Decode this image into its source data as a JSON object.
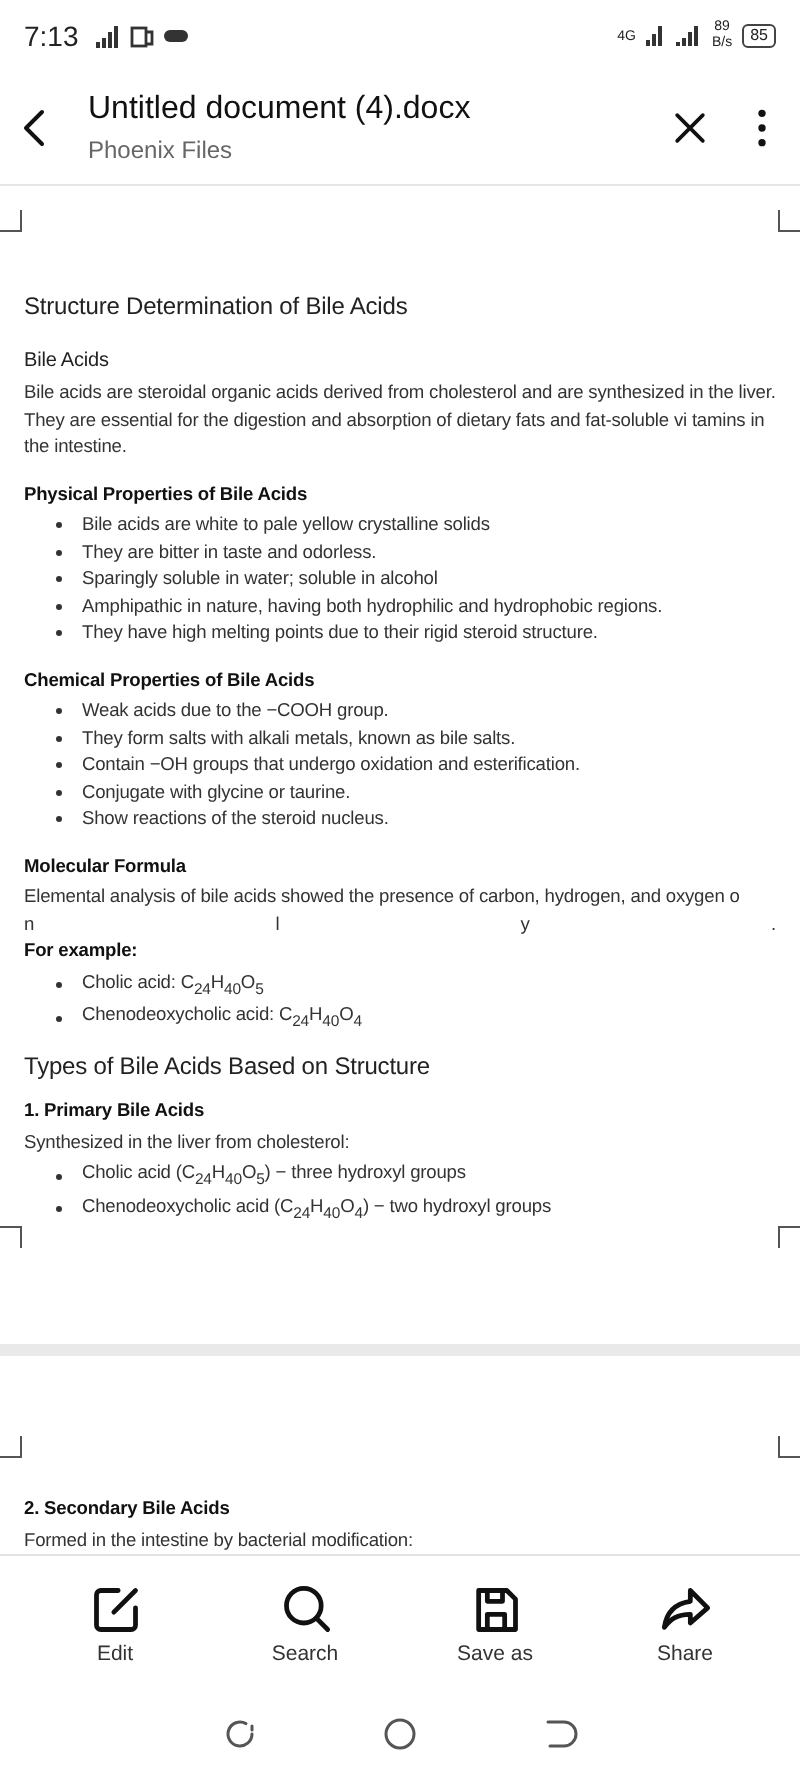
{
  "status_bar": {
    "time": "7:13",
    "network": "4G",
    "speed_value": "89",
    "speed_unit": "B/s",
    "battery": "85"
  },
  "header": {
    "title": "Untitled document (4).docx",
    "subtitle": "Phoenix Files"
  },
  "pages": [
    {
      "blocks": [
        {
          "kind": "title",
          "text": "Structure Determination of Bile Acids"
        },
        {
          "kind": "heading",
          "text": "Bile Acids"
        },
        {
          "kind": "paragraph",
          "text": "Bile acids are steroidal organic acids derived from cholesterol and are synthesized in the liver. They are essential for the digestion and absorption of dietary fats and fat-soluble vi tamins in the intestine."
        },
        {
          "kind": "bold",
          "text": "Physical Properties of Bile Acids"
        },
        {
          "kind": "list",
          "items": [
            "Bile acids are white to pale yellow crystalline solids",
            "They are bitter in taste and odorless.",
            "Sparingly soluble in water; soluble in alcohol",
            "Amphipathic in nature, having both hydrophilic and hydrophobic regions.",
            "They have high melting points due to their rigid steroid structure."
          ]
        },
        {
          "kind": "bold",
          "text": "Chemical Properties of Bile Acids"
        },
        {
          "kind": "list",
          "items": [
            "Weak acids due to the −COOH group.",
            "They form salts with alkali metals, known as bile salts.",
            "Contain −OH groups that undergo oxidation and esterification.",
            "Conjugate with glycine or taurine.",
            "Show reactions of the steroid nucleus."
          ]
        },
        {
          "kind": "bold",
          "text": "Molecular Formula"
        },
        {
          "kind": "paragraph",
          "text": "Elemental analysis of bile acids showed the presence of carbon, hydrogen, and oxygen o"
        },
        {
          "kind": "spread",
          "items": [
            "n",
            "l",
            "y",
            "."
          ]
        },
        {
          "kind": "bold_tight",
          "text": "For example:"
        },
        {
          "kind": "list",
          "items": [
            "Cholic acid: C$_{24}$H$_{40}$O$_{5}$",
            "Chenodeoxycholic acid: C$_{24}$H$_{40}$O$_{4}$"
          ]
        },
        {
          "kind": "title",
          "text": "Types of Bile Acids Based on Structure"
        },
        {
          "kind": "bold",
          "text": "1. Primary Bile Acids"
        },
        {
          "kind": "paragraph",
          "text": "Synthesized in the liver from cholesterol:"
        },
        {
          "kind": "list",
          "items": [
            "Cholic acid (C$_{24}$H$_{40}$O$_{5}$) − three hydroxyl groups",
            "Chenodeoxycholic acid (C$_{24}$H$_{40}$O$_{4}$) − two hydroxyl groups"
          ]
        }
      ]
    },
    {
      "blocks": [
        {
          "kind": "bold",
          "text": "2. Secondary Bile Acids"
        },
        {
          "kind": "paragraph",
          "text": "Formed in the intestine by bacterial modification:"
        }
      ]
    }
  ],
  "toolbar": [
    {
      "label": "Edit",
      "kind": "edit"
    },
    {
      "label": "Search",
      "kind": "search"
    },
    {
      "label": "Save as",
      "kind": "save"
    },
    {
      "label": "Share",
      "kind": "share"
    }
  ]
}
